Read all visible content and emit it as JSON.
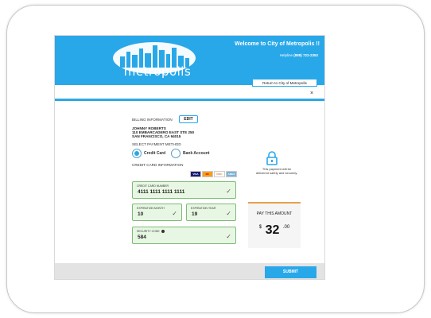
{
  "header": {
    "welcome": "Welcome to City of Metropolis !!",
    "helpline_label": "Helpline",
    "helpline_number": "(888) 722-2352",
    "return_button": "Return to City of Metropolis",
    "logo_text": "metropolis"
  },
  "close_label": "×",
  "billing": {
    "label": "BILLING INFORMATION",
    "edit_button": "EDIT",
    "name": "JOHNNY ROBERTS",
    "address1": "110 EMBARCADERO EAST STE 250",
    "address2": "SAN FRANCISCO, CA 94015"
  },
  "payment_method": {
    "label": "SELECT PAYMENT METHOD",
    "options": [
      "Credit Card",
      "Bank Account"
    ],
    "selected": "Credit Card"
  },
  "credit_card": {
    "label": "CREDIT CARD INFORMATION",
    "card_logos": [
      "VISA",
      "MC",
      "DISC",
      "AMEX"
    ],
    "number_label": "CREDIT CARD NUMBER",
    "number_value": "4111 1111 1111 1111",
    "exp_month_label": "EXPIRATION MONTH",
    "exp_month_value": "10",
    "exp_year_label": "EXPIRATION YEAR",
    "exp_year_value": "19",
    "security_label": "SECURITY CODE",
    "security_value": "584"
  },
  "secure": {
    "line1": "This payment will be",
    "line2": "delivered safely and securely."
  },
  "pay": {
    "title": "PAY THIS AMOUNT",
    "currency": "$",
    "whole": "32",
    "cents": ".00"
  },
  "submit_button": "SUBMIT",
  "colors": {
    "accent": "#29a8e9",
    "field_bg": "#e8f7e3",
    "field_border": "#7dbb77",
    "pay_border": "#e8a04b"
  }
}
